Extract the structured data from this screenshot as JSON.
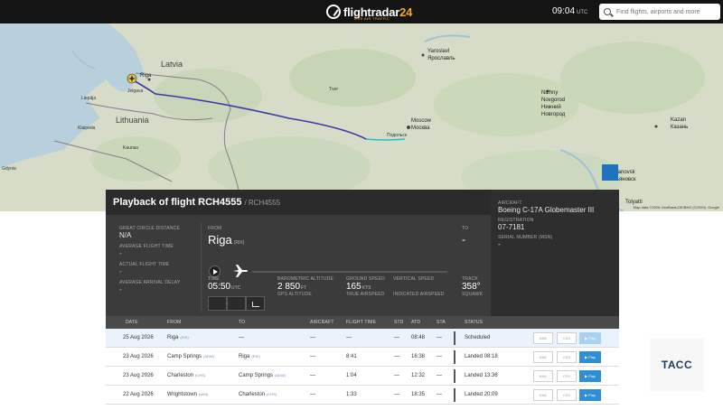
{
  "header": {
    "logo_name": "flightradar",
    "logo_num": "24",
    "logo_sub": "LIVE AIR TRAFFIC",
    "time": "09:04",
    "time_zone": "UTC",
    "search_placeholder": "Find flights, airports and more"
  },
  "map": {
    "labels": {
      "latvia": "Latvia",
      "lithuania": "Lithuania",
      "riga": "Riga",
      "jelgava": "Jelgava",
      "liepaja": "Liepāja",
      "klaipeda": "Klaipėda",
      "kaunas": "Kaunas",
      "gdynia": "Gdynia",
      "moscow": "Moscow",
      "moscow_ru": "Москва",
      "yaroslavl": "Yaroslavl",
      "yaroslavl_ru": "Ярославль",
      "nizhny": "Nizhny",
      "novgorod": "Novgorod",
      "nizhny_ru": "Нижний",
      "novgorod_ru": "Новгород",
      "kazan": "Kazan",
      "kazan_ru": "Казань",
      "ulyanovsk": "Ulyanovsk",
      "ulyanovsk_ru": "Ульяновск",
      "tolyatti": "Tolyatti",
      "tver": "Tver",
      "podolsk": "Подольск"
    },
    "attribution": "Map data ©2026 GeoBasis-DE/BKG (©2009), Google"
  },
  "flight": {
    "title": "Playback of flight RCH4555",
    "subtitle": "/ RCH4555",
    "great_circle_label": "GREAT CIRCLE DISTANCE",
    "great_circle_value": "N/A",
    "avg_flight_time_label": "AVERAGE FLIGHT TIME",
    "avg_flight_time_value": "-",
    "actual_flight_time_label": "ACTUAL FLIGHT TIME",
    "actual_flight_time_value": "-",
    "avg_arrival_delay_label": "AVERAGE ARRIVAL DELAY",
    "avg_arrival_delay_value": "-",
    "from_label": "FROM",
    "from_city": "Riga",
    "from_code": "(RIX)",
    "to_label": "TO",
    "to_city": "-",
    "time_label": "TIME",
    "time_value": "05:50",
    "time_unit": "UTC",
    "baro_alt_label": "BAROMETRIC ALTITUDE",
    "baro_alt_value": "2 850",
    "baro_alt_unit": "FT",
    "gps_alt_label": "GPS ALTITUDE",
    "ground_speed_label": "GROUND SPEED",
    "ground_speed_value": "165",
    "ground_speed_unit": "KTS",
    "true_airspeed_label": "TRUE AIRSPEED",
    "vertical_speed_label": "VERTICAL SPEED",
    "indicated_airspeed_label": "INDICATED AIRSPEED",
    "track_label": "TRACK",
    "track_value": "358°",
    "squawk_label": "SQUAWK",
    "progress": 0.0
  },
  "aircraft": {
    "aircraft_label": "AIRCRAFT",
    "aircraft_value": "Boeing C-17A Globemaster III",
    "registration_label": "REGISTRATION",
    "registration_value": "07-7181",
    "serial_label": "SERIAL NUMBER (MSN)",
    "serial_value": "-"
  },
  "table": {
    "headers": [
      "DATE",
      "FROM",
      "TO",
      "AIRCRAFT",
      "FLIGHT TIME",
      "STD",
      "ATD",
      "STA",
      "STATUS"
    ],
    "rows": [
      {
        "date": "25 Aug 2026",
        "from": "Riga",
        "from_code": "(RIX)",
        "to": "—",
        "to_code": "",
        "aircraft": "—",
        "flight_time": "—",
        "std": "—",
        "atd": "08:48",
        "sta": "—",
        "status": "Scheduled"
      },
      {
        "date": "23 Aug 2026",
        "from": "Camp Springs",
        "from_code": "(ADW)",
        "to": "Riga",
        "to_code": "(RIX)",
        "aircraft": "—",
        "flight_time": "8:41",
        "std": "—",
        "atd": "16:38",
        "sta": "—",
        "status": "Landed 08:18"
      },
      {
        "date": "23 Aug 2026",
        "from": "Charleston",
        "from_code": "(CHS)",
        "to": "Camp Springs",
        "to_code": "(ADW)",
        "aircraft": "—",
        "flight_time": "1:04",
        "std": "—",
        "atd": "12:32",
        "sta": "—",
        "status": "Landed 13:36"
      },
      {
        "date": "22 Aug 2026",
        "from": "Wrightstown",
        "from_code": "(WRI)",
        "to": "Charleston",
        "to_code": "(CHS)",
        "aircraft": "—",
        "flight_time": "1:33",
        "std": "—",
        "atd": "18:35",
        "sta": "—",
        "status": "Landed 20:09"
      }
    ],
    "kml_label": "KML",
    "csv_label": "CSV",
    "play_label": "▶ Play"
  },
  "watermark": {
    "text": "ТАСС"
  }
}
